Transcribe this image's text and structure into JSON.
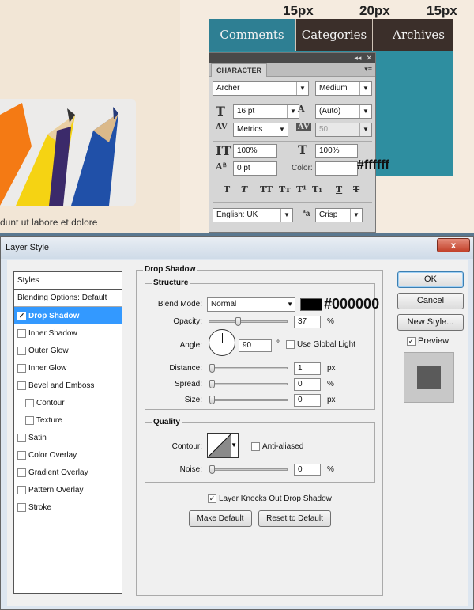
{
  "website": {
    "spacing_labels": [
      "15px",
      "20px",
      "15px"
    ],
    "nav_tabs": [
      {
        "label": "Comments"
      },
      {
        "label": "Categories"
      },
      {
        "label": "Archives"
      }
    ],
    "body_text": "dunt ut labore et dolore",
    "color_annotation_white": "#ffffff",
    "colors": {
      "teal": "#2e7f93",
      "dark_brown": "#3b2f2a",
      "cream": "#f2e6d6"
    }
  },
  "character_panel": {
    "tab_label": "CHARACTER",
    "font_family": "Archer",
    "font_style": "Medium",
    "font_size": "16 pt",
    "leading": "(Auto)",
    "kerning": "Metrics",
    "tracking": "50",
    "vertical_scale": "100%",
    "horizontal_scale": "100%",
    "baseline_shift": "0 pt",
    "color_label": "Color:",
    "format_buttons": [
      "T",
      "T",
      "TT",
      "Tт",
      "T¹",
      "T₁",
      "T",
      "T"
    ],
    "language": "English: UK",
    "antialias_label": "ªa",
    "antialias": "Crisp"
  },
  "layer_style": {
    "title": "Layer Style",
    "close_label": "x",
    "styles_header": "Styles",
    "blending_options": "Blending Options: Default",
    "style_items": [
      {
        "label": "Drop Shadow",
        "checked": true,
        "selected": true,
        "sub": false
      },
      {
        "label": "Inner Shadow",
        "checked": false,
        "selected": false,
        "sub": false
      },
      {
        "label": "Outer Glow",
        "checked": false,
        "selected": false,
        "sub": false
      },
      {
        "label": "Inner Glow",
        "checked": false,
        "selected": false,
        "sub": false
      },
      {
        "label": "Bevel and Emboss",
        "checked": false,
        "selected": false,
        "sub": false
      },
      {
        "label": "Contour",
        "checked": false,
        "selected": false,
        "sub": true
      },
      {
        "label": "Texture",
        "checked": false,
        "selected": false,
        "sub": true
      },
      {
        "label": "Satin",
        "checked": false,
        "selected": false,
        "sub": false
      },
      {
        "label": "Color Overlay",
        "checked": false,
        "selected": false,
        "sub": false
      },
      {
        "label": "Gradient Overlay",
        "checked": false,
        "selected": false,
        "sub": false
      },
      {
        "label": "Pattern Overlay",
        "checked": false,
        "selected": false,
        "sub": false
      },
      {
        "label": "Stroke",
        "checked": false,
        "selected": false,
        "sub": false
      }
    ],
    "drop_shadow_title": "Drop Shadow",
    "structure_title": "Structure",
    "blend_mode_label": "Blend Mode:",
    "blend_mode": "Normal",
    "shadow_color": "#000000",
    "color_annotation_black": "#000000",
    "opacity_label": "Opacity:",
    "opacity": "37",
    "angle_label": "Angle:",
    "angle": "90",
    "degree_symbol": "°",
    "global_light_label": "Use Global Light",
    "distance_label": "Distance:",
    "distance": "1",
    "spread_label": "Spread:",
    "spread": "0",
    "size_label": "Size:",
    "size": "0",
    "unit_px": "px",
    "unit_pct": "%",
    "quality_title": "Quality",
    "contour_label": "Contour:",
    "anti_aliased_label": "Anti-aliased",
    "noise_label": "Noise:",
    "noise": "0",
    "knockout_label": "Layer Knocks Out Drop Shadow",
    "make_default": "Make Default",
    "reset_default": "Reset to Default",
    "ok": "OK",
    "cancel": "Cancel",
    "new_style": "New Style...",
    "preview_label": "Preview"
  }
}
